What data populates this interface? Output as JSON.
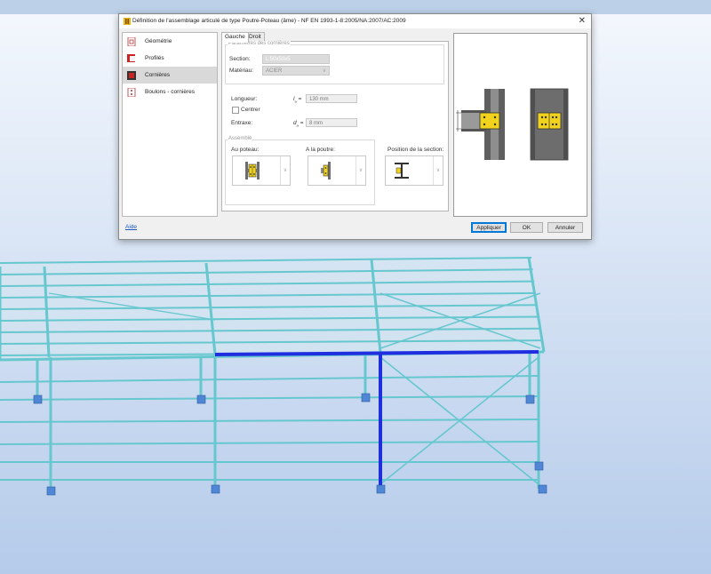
{
  "dialog": {
    "title": "Définition de l'assemblage articulé de type Poutre-Poteau (âme) - NF EN 1993-1-8:2005/NA:2007/AC:2009",
    "close_glyph": "✕",
    "nav": [
      {
        "label": "Géométrie",
        "icon": "geometry-icon"
      },
      {
        "label": "Profilés",
        "icon": "profiles-icon"
      },
      {
        "label": "Cornières",
        "icon": "angles-icon",
        "active": true
      },
      {
        "label": "Boulons - cornières",
        "icon": "bolts-icon"
      }
    ],
    "tabs": [
      "Gauche",
      "Droit"
    ],
    "panel": {
      "params_title": "Paramètres des cornières",
      "section_label": "Section:",
      "section_value": "L 50x50x5",
      "material_label": "Matériau:",
      "material_value": "ACIER",
      "length_label": "Longueur:",
      "length_symbol": "l",
      "length_sub": "a",
      "length_value": "130 mm",
      "center_label": "Centrer",
      "spacing_label": "Entraxe:",
      "spacing_symbol": "d",
      "spacing_sub": "a",
      "spacing_value": "8 mm",
      "equals": "=",
      "assembly_title": "Assemblé",
      "column_label": "Au poteau:",
      "beam_label": "A la poutre:",
      "section_pos_label": "Position de la section:"
    },
    "help_link": "Aide",
    "buttons": {
      "apply": "Appliquer",
      "ok": "OK",
      "cancel": "Annuler"
    }
  },
  "colors": {
    "structure": "#67c7cf",
    "structure_edge": "#2d8f9a",
    "highlight": "#1f2fe0",
    "accent_yellow": "#f1d21d",
    "steel": "#6d6d6d"
  }
}
